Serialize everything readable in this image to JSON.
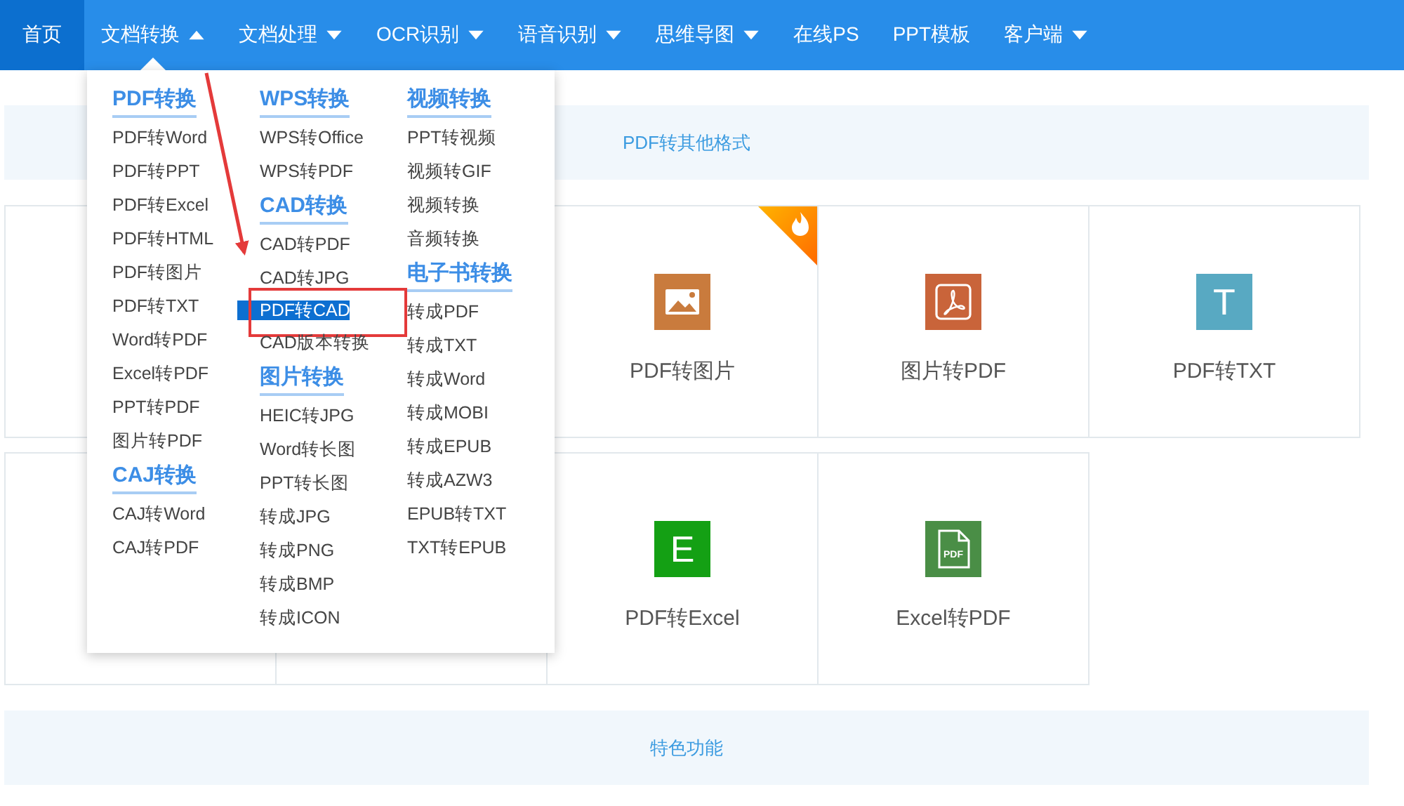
{
  "nav": [
    {
      "label": "首页",
      "selected": true,
      "dropdown": false,
      "expanded": false
    },
    {
      "label": "文档转换",
      "selected": false,
      "dropdown": true,
      "expanded": true
    },
    {
      "label": "文档处理",
      "selected": false,
      "dropdown": true,
      "expanded": false
    },
    {
      "label": "OCR识别",
      "selected": false,
      "dropdown": true,
      "expanded": false
    },
    {
      "label": "语音识别",
      "selected": false,
      "dropdown": true,
      "expanded": false
    },
    {
      "label": "思维导图",
      "selected": false,
      "dropdown": true,
      "expanded": false
    },
    {
      "label": "在线PS",
      "selected": false,
      "dropdown": false,
      "expanded": false
    },
    {
      "label": "PPT模板",
      "selected": false,
      "dropdown": false,
      "expanded": false
    },
    {
      "label": "客户端",
      "selected": false,
      "dropdown": true,
      "expanded": false
    }
  ],
  "menu": {
    "annotated": true,
    "columns": [
      [
        {
          "title": "PDF转换",
          "items": [
            {
              "label": "PDF转Word",
              "selected": false
            },
            {
              "label": "PDF转PPT",
              "selected": false
            },
            {
              "label": "PDF转Excel",
              "selected": false
            },
            {
              "label": "PDF转HTML",
              "selected": false
            },
            {
              "label": "PDF转图片",
              "selected": false
            },
            {
              "label": "PDF转TXT",
              "selected": false
            },
            {
              "label": "Word转PDF",
              "selected": false
            },
            {
              "label": "Excel转PDF",
              "selected": false
            },
            {
              "label": "PPT转PDF",
              "selected": false
            },
            {
              "label": "图片转PDF",
              "selected": false
            }
          ]
        },
        {
          "title": "CAJ转换",
          "items": [
            {
              "label": "CAJ转Word",
              "selected": false
            },
            {
              "label": "CAJ转PDF",
              "selected": false
            }
          ]
        }
      ],
      [
        {
          "title": "WPS转换",
          "items": [
            {
              "label": "WPS转Office",
              "selected": false
            },
            {
              "label": "WPS转PDF",
              "selected": false
            }
          ]
        },
        {
          "title": "CAD转换",
          "items": [
            {
              "label": "CAD转PDF",
              "selected": false
            },
            {
              "label": "CAD转JPG",
              "selected": false
            },
            {
              "label": "PDF转CAD",
              "selected": true
            },
            {
              "label": "CAD版本转换",
              "selected": false
            }
          ]
        },
        {
          "title": "图片转换",
          "items": [
            {
              "label": "HEIC转JPG",
              "selected": false
            },
            {
              "label": "Word转长图",
              "selected": false
            },
            {
              "label": "PPT转长图",
              "selected": false
            },
            {
              "label": "转成JPG",
              "selected": false
            },
            {
              "label": "转成PNG",
              "selected": false
            },
            {
              "label": "转成BMP",
              "selected": false
            },
            {
              "label": "转成ICON",
              "selected": false
            }
          ]
        }
      ],
      [
        {
          "title": "视频转换",
          "items": [
            {
              "label": "PPT转视频",
              "selected": false
            },
            {
              "label": "视频转GIF",
              "selected": false
            },
            {
              "label": "视频转换",
              "selected": false
            },
            {
              "label": "音频转换",
              "selected": false
            }
          ]
        },
        {
          "title": "电子书转换",
          "items": [
            {
              "label": "转成PDF",
              "selected": false
            },
            {
              "label": "转成TXT",
              "selected": false
            },
            {
              "label": "转成Word",
              "selected": false
            },
            {
              "label": "转成MOBI",
              "selected": false
            },
            {
              "label": "转成EPUB",
              "selected": false
            },
            {
              "label": "转成AZW3",
              "selected": false
            },
            {
              "label": "EPUB转TXT",
              "selected": false
            },
            {
              "label": "TXT转EPUB",
              "selected": false
            }
          ]
        }
      ]
    ]
  },
  "section_1": {
    "title": "PDF转其他格式",
    "rows": [
      [
        {
          "covered": true
        },
        "",
        {
          "covered": false,
          "label": "PDF转图片",
          "kind": "image",
          "color": "#c97b3d",
          "hot": true
        },
        {
          "covered": false,
          "label": "图片转PDF",
          "kind": "pdf",
          "color": "#c9643a",
          "hot": false
        },
        {
          "covered": false,
          "label": "PDF转TXT",
          "kind": "glyph",
          "glyph": "T",
          "color": "#58a9c2",
          "hot": false
        }
      ],
      [
        {
          "covered": true
        },
        {
          "covered": true
        },
        {
          "covered": false,
          "label": "PDF转Excel",
          "kind": "glyph",
          "glyph": "E",
          "color": "#14a014",
          "hot": false
        },
        {
          "covered": false,
          "label": "Excel转PDF",
          "kind": "file",
          "glyph": "PDF",
          "color": "#4a8e46",
          "hot": false
        }
      ]
    ]
  },
  "section_2": {
    "title": "特色功能"
  }
}
